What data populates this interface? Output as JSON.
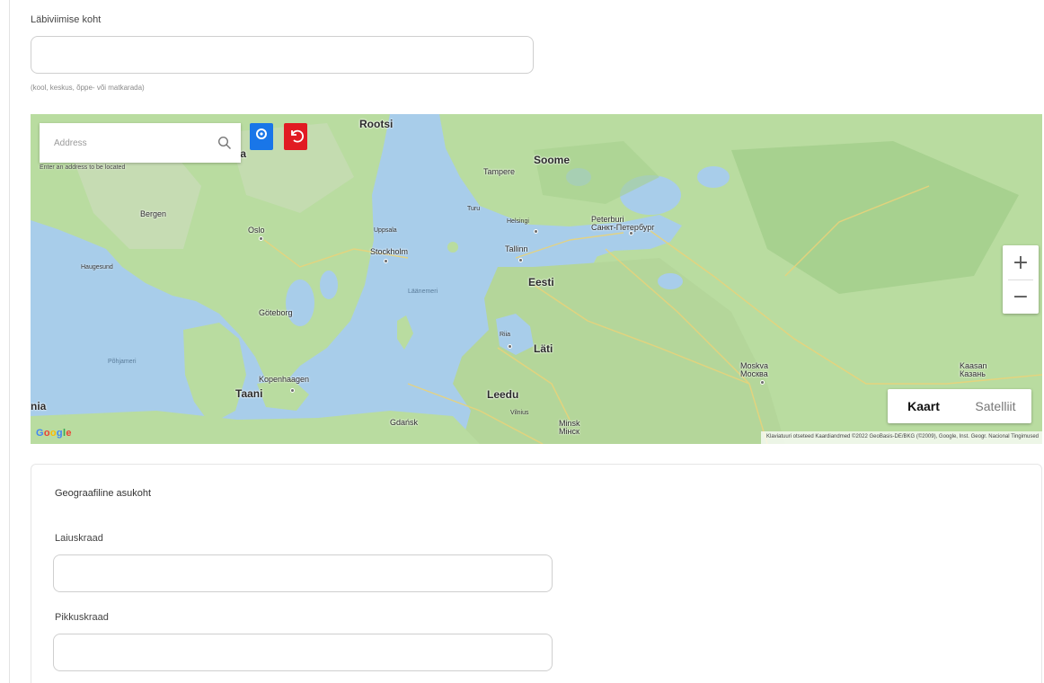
{
  "location_field": {
    "label": "Läbiviimise koht",
    "value": "",
    "hint": "(kool, keskus, õppe- või matkarada)"
  },
  "map": {
    "search_placeholder": "Address",
    "search_hint": "Enter an address to be located",
    "zoom_in": "+",
    "zoom_out": "−",
    "type_map": "Kaart",
    "type_satellite": "Satelliit",
    "attribution": "Klaviatuuri otseteed   Kaardiandmed ©2022 GeoBasis-DE/BKG (©2009), Google, Inst. Geogr. Nacional   Tingimused",
    "logo": [
      "G",
      "o",
      "o",
      "g",
      "l",
      "e"
    ],
    "labels": {
      "rootsi": "Rootsi",
      "norra": "Norra",
      "soome": "Soome",
      "tampere": "Tampere",
      "turu": "Turu",
      "helsingi": "Helsingi",
      "peterburi": "Peterburi\nСанкт-Петербург",
      "bergen": "Bergen",
      "oslo": "Oslo",
      "uppsala": "Uppsala",
      "stockholm": "Stockholm",
      "haugesund": "Haugesund",
      "tallinn": "Tallinn",
      "eesti": "Eesti",
      "laanemeri": "Läänemeri",
      "goteborg": "Göteborg",
      "riia": "Riia",
      "lati": "Läti",
      "pohjameri": "Põhjameri",
      "kopenhaagen": "Kopenhaagen",
      "taani": "Taani",
      "leedu": "Leedu",
      "vilnius": "Vilnius",
      "gdansk": "Gdańsk",
      "minsk": "Minsk\nМінск",
      "moskva": "Moskva\nМосква",
      "kaasan": "Kaasan\nКазань",
      "nia": "nia"
    }
  },
  "geo": {
    "title": "Geograafiline asukoht",
    "latitude_label": "Laiuskraad",
    "latitude_value": "",
    "longitude_label": "Pikkuskraad",
    "longitude_value": ""
  },
  "colors": {
    "water": "#a8cdea",
    "land": "#b9dca0",
    "locate_button": "#1976e8",
    "reset_button": "#e11b22"
  }
}
